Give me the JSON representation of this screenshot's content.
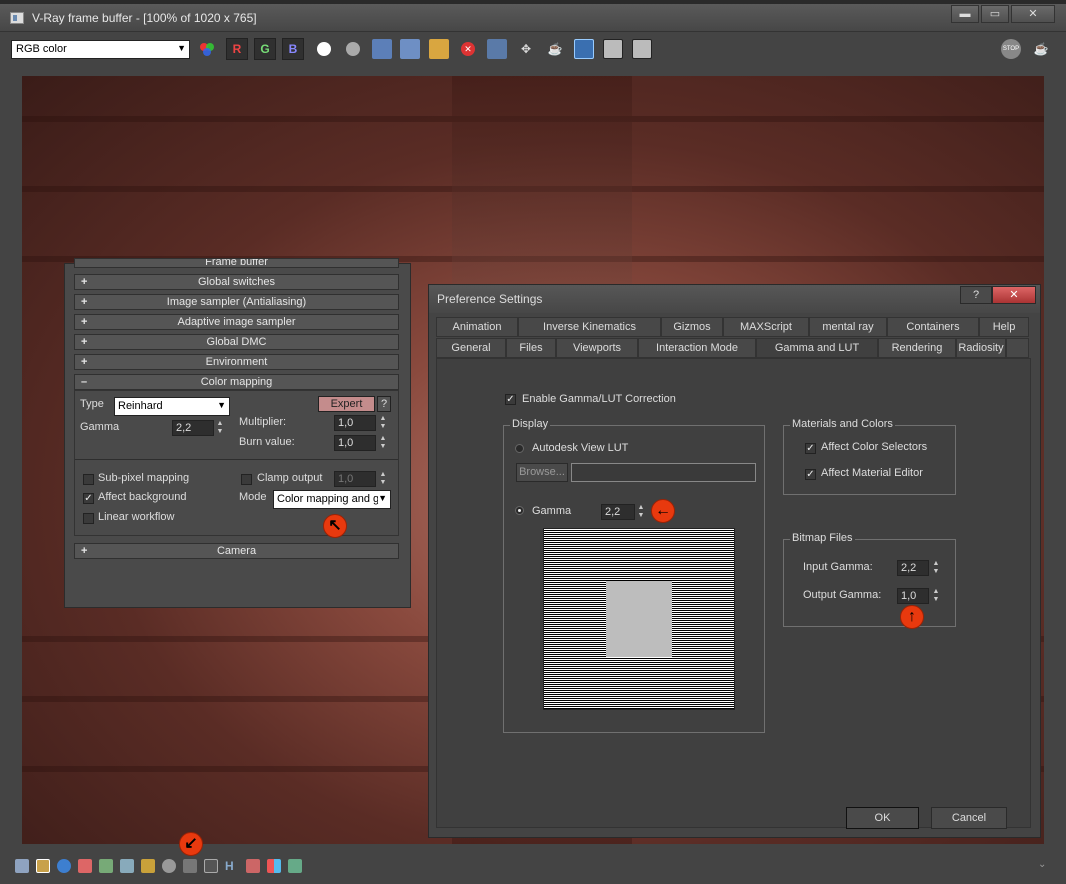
{
  "window": {
    "title": "V-Ray frame buffer - [100% of 1020 x 765]",
    "minimize": "▬",
    "restore": "▭",
    "close": "✕"
  },
  "toolbar": {
    "channel": "RGB color",
    "r_label": "R",
    "g_label": "G",
    "b_label": "B",
    "stop_label": "STOP"
  },
  "vray_panel": {
    "top_item": "Frame buffer",
    "rollouts": [
      {
        "sign": "+",
        "label": "Global switches"
      },
      {
        "sign": "+",
        "label": "Image sampler (Antialiasing)"
      },
      {
        "sign": "+",
        "label": "Adaptive image sampler"
      },
      {
        "sign": "+",
        "label": "Global DMC"
      },
      {
        "sign": "+",
        "label": "Environment"
      },
      {
        "sign": "–",
        "label": "Color mapping"
      }
    ],
    "camera": {
      "sign": "+",
      "label": "Camera"
    },
    "color_mapping": {
      "type_label": "Type",
      "type_value": "Reinhard",
      "expert_label": "Expert",
      "help_label": "?",
      "gamma_label": "Gamma",
      "gamma_value": "2,2",
      "multiplier_label": "Multiplier:",
      "multiplier_value": "1,0",
      "burn_label": "Burn value:",
      "burn_value": "1,0",
      "subpixel_label": "Sub-pixel mapping",
      "clamp_label": "Clamp output",
      "clamp_value": "1,0",
      "affect_bg_label": "Affect background",
      "mode_label": "Mode",
      "mode_value": "Color mapping and g",
      "linear_label": "Linear workflow"
    }
  },
  "pref": {
    "title": "Preference Settings",
    "help_btn": "?",
    "close_btn": "✕",
    "tabs_row1": [
      "Animation",
      "Inverse Kinematics",
      "Gizmos",
      "MAXScript",
      "mental ray",
      "Containers",
      "Help"
    ],
    "tabs_row2": [
      "General",
      "Files",
      "Viewports",
      "Interaction Mode",
      "Gamma and LUT",
      "Rendering",
      "Radiosity"
    ],
    "enable_label": "Enable Gamma/LUT Correction",
    "display_group": "Display",
    "lut_label": "Autodesk View LUT",
    "browse_label": "Browse...",
    "gamma_label": "Gamma",
    "gamma_value": "2,2",
    "materials_group": "Materials and Colors",
    "affect_color_label": "Affect Color Selectors",
    "affect_material_label": "Affect Material Editor",
    "bitmap_group": "Bitmap Files",
    "input_gamma_label": "Input Gamma:",
    "input_gamma_value": "2,2",
    "output_gamma_label": "Output Gamma:",
    "output_gamma_value": "1,0",
    "ok_label": "OK",
    "cancel_label": "Cancel"
  },
  "status_icons": [
    "folder-icon",
    "save-icon",
    "info-icon",
    "rgb-icon",
    "lab-icon",
    "histogram-icon",
    "color-correction-icon",
    "color-wheel-icon",
    "curve-icon",
    "lut-icon",
    "h-icon",
    "levels-icon",
    "compare-icon",
    "settings-icon"
  ],
  "colors": {
    "callout": "#e8390e",
    "render_dark": "#3a1c18",
    "render_light": "#b4766a"
  }
}
